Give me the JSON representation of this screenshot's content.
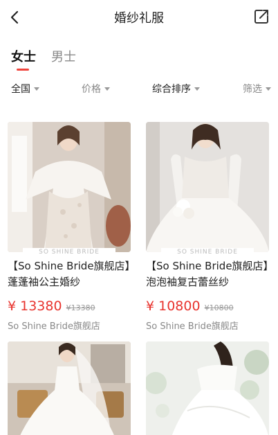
{
  "header": {
    "title": "婚纱礼服",
    "back_icon": "chevron-left-icon",
    "share_icon": "share-icon"
  },
  "gender_tabs": [
    {
      "label": "女士",
      "active": true
    },
    {
      "label": "男士",
      "active": false
    }
  ],
  "filters": [
    {
      "label": "全国"
    },
    {
      "label": "价格"
    },
    {
      "label": "综合排序"
    },
    {
      "label": "筛选"
    }
  ],
  "products": [
    {
      "name": "【So Shine Bride旗舰店】蓬蓬袖公主婚纱",
      "price": "¥ 13380",
      "original_price": "¥13380",
      "shop": "So Shine Bride旗舰店",
      "brand_strip": "SO SHINE BRIDE"
    },
    {
      "name": "【So Shine Bride旗舰店】泡泡袖复古蕾丝纱",
      "price": "¥ 10800",
      "original_price": "¥10800",
      "shop": "So Shine Bride旗舰店",
      "brand_strip": "SO SHINE BRIDE"
    }
  ],
  "colors": {
    "accent": "#e8332d",
    "tab_indicator": "#f0433b"
  }
}
